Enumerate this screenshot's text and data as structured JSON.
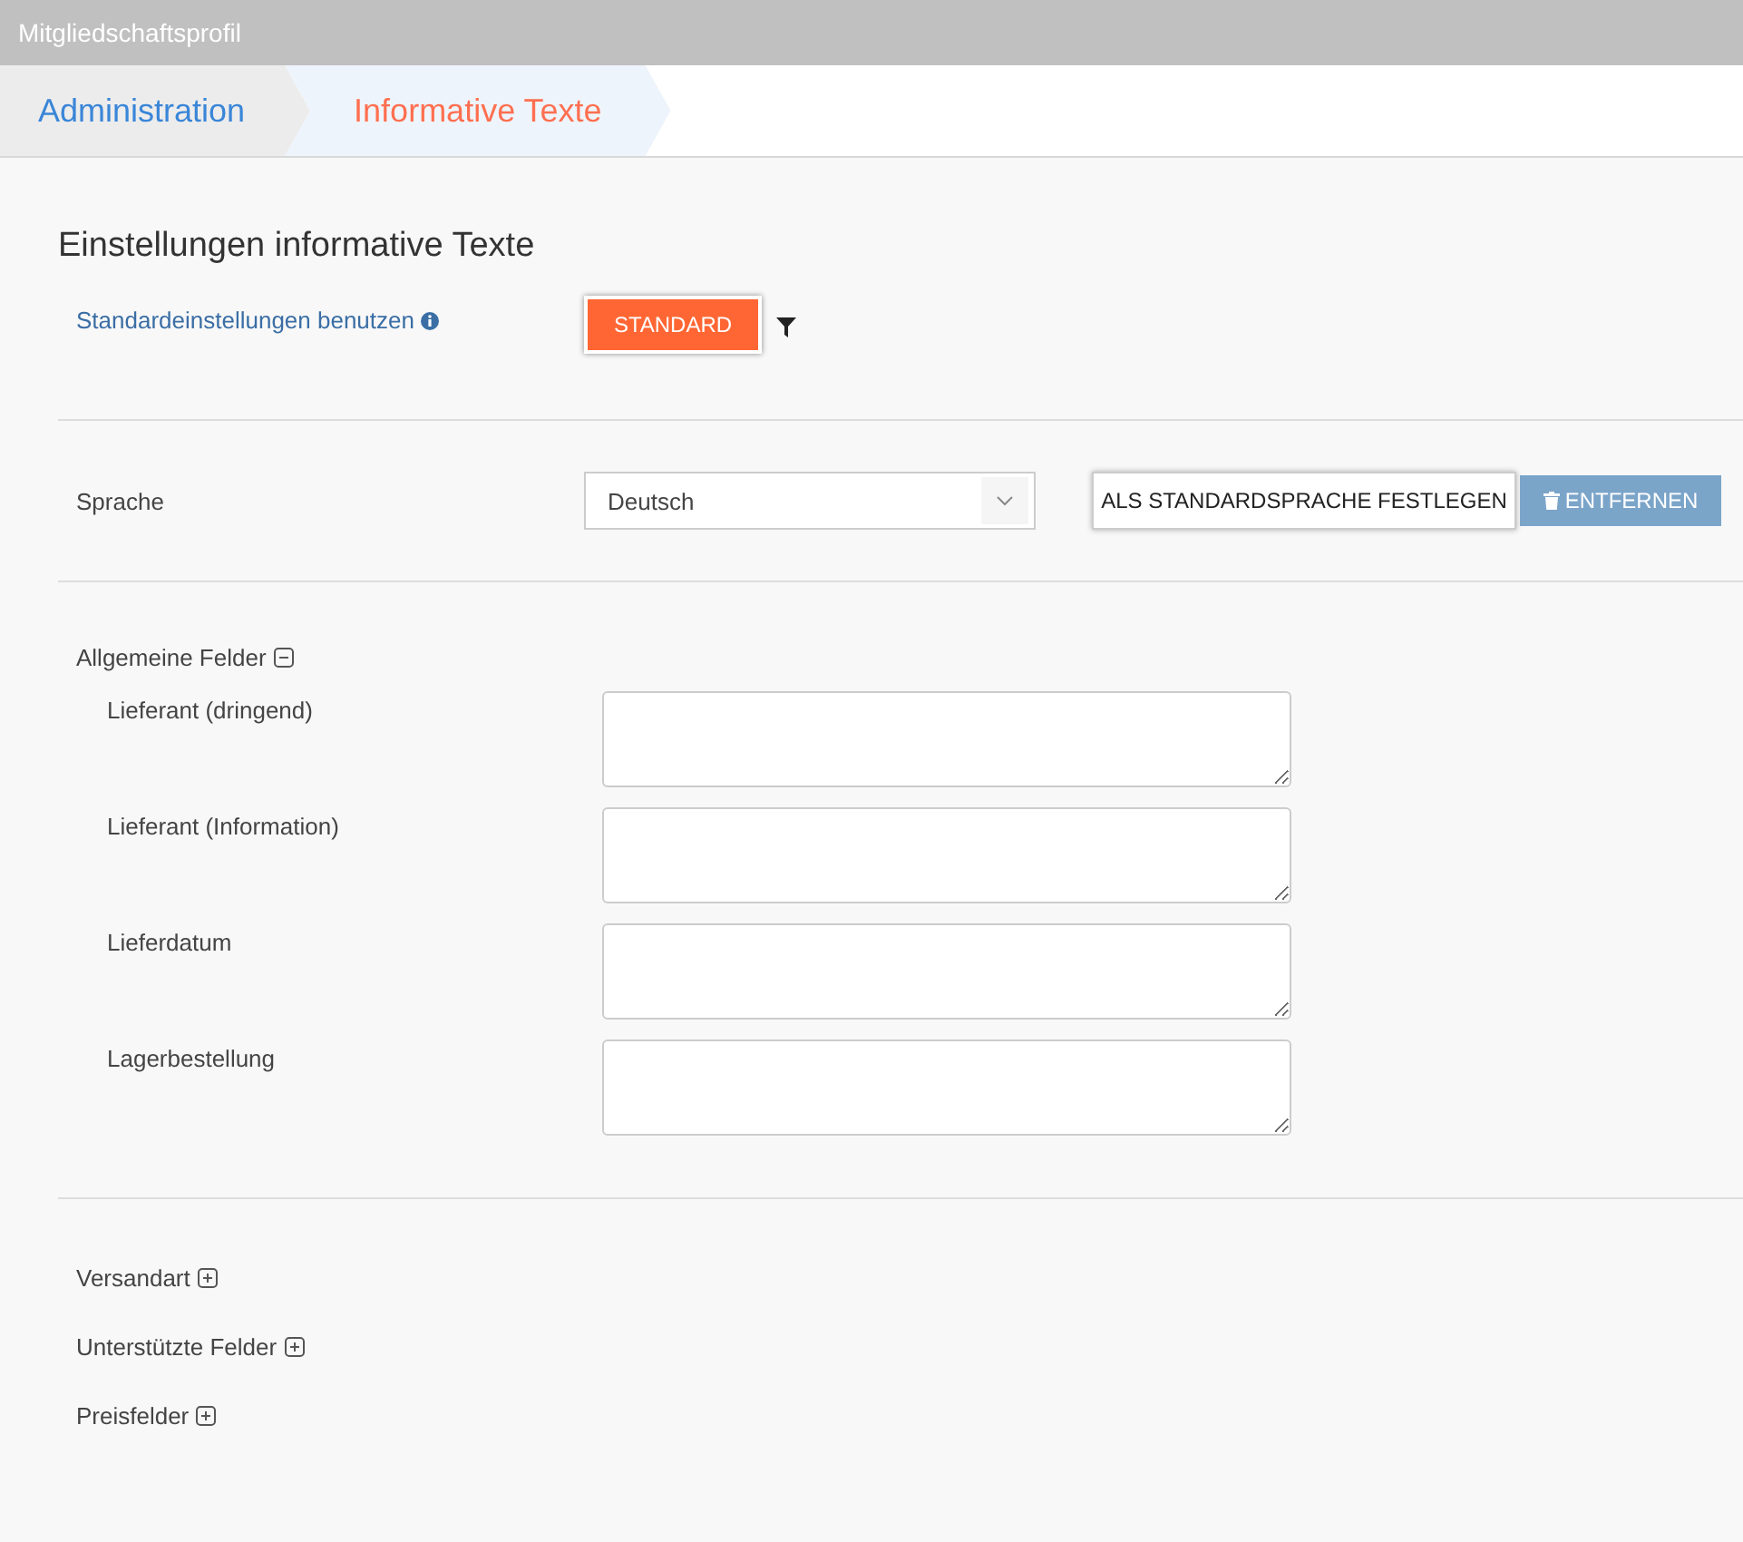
{
  "window": {
    "title": "Mitgliedschaftsprofil"
  },
  "breadcrumb": [
    {
      "label": "Administration",
      "selected": false
    },
    {
      "label": "Informative Texte",
      "selected": true
    }
  ],
  "heading": "Einstellungen informative Texte",
  "defaults": {
    "label": "Standardeinstellungen benutzen",
    "button": "STANDARD"
  },
  "language": {
    "label": "Sprache",
    "value": "Deutsch",
    "set_default_button": "ALS STANDARDSPRACHE FESTLEGEN",
    "remove_button": "ENTFERNEN"
  },
  "sections": [
    {
      "title": "Allgemeine Felder",
      "expanded": true,
      "fields": [
        {
          "label": "Lieferant (dringend)"
        },
        {
          "label": "Lieferant (Information)"
        },
        {
          "label": "Lieferdatum"
        },
        {
          "label": "Lagerbestellung"
        }
      ]
    },
    {
      "title": "Versandart",
      "expanded": false
    },
    {
      "title": "Unterstützte Felder",
      "expanded": false
    },
    {
      "title": "Preisfelder",
      "expanded": false
    }
  ]
}
